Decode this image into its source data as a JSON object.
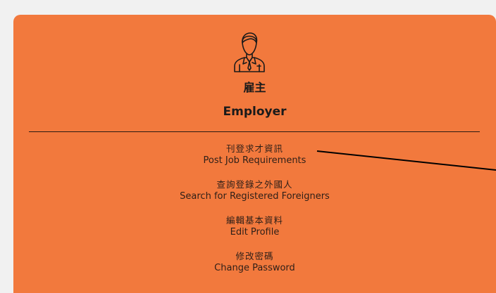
{
  "card": {
    "background": "#f2793d",
    "icon": "employer-avatar-icon",
    "role_zh": "雇主",
    "role_en": "Employer"
  },
  "menu": [
    {
      "zh": "刊登求才資訊",
      "en": "Post Job Requirements"
    },
    {
      "zh": "查詢登錄之外國人",
      "en": "Search for Registered Foreigners"
    },
    {
      "zh": "編輯基本資料",
      "en": "Edit Profile"
    },
    {
      "zh": "修改密碼",
      "en": "Change Password"
    }
  ]
}
